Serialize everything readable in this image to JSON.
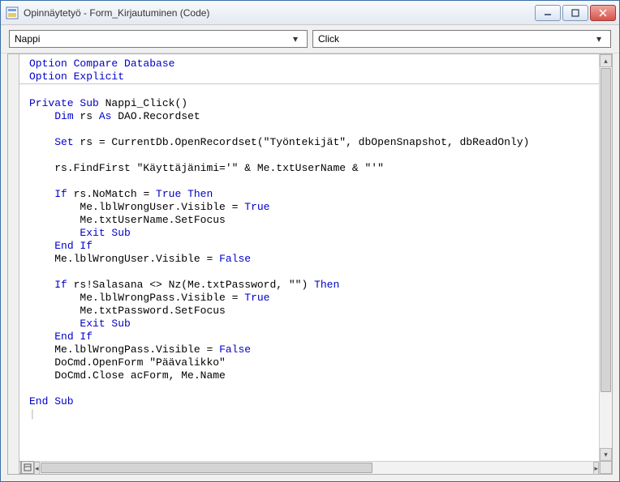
{
  "window": {
    "title": "Opinnäytetyö - Form_Kirjautuminen (Code)"
  },
  "dropdowns": {
    "object": "Nappi",
    "procedure": "Click"
  },
  "code": {
    "lines": [
      {
        "indent": 0,
        "tokens": [
          {
            "t": "Option Compare Database",
            "c": "kw"
          }
        ]
      },
      {
        "indent": 0,
        "tokens": [
          {
            "t": "Option Explicit",
            "c": "kw"
          }
        ]
      },
      {
        "hr": true
      },
      {
        "blank": true
      },
      {
        "indent": 0,
        "tokens": [
          {
            "t": "Private Sub",
            "c": "kw"
          },
          {
            "t": " Nappi_Click()"
          }
        ]
      },
      {
        "indent": 1,
        "tokens": [
          {
            "t": "Dim",
            "c": "kw"
          },
          {
            "t": " rs "
          },
          {
            "t": "As",
            "c": "kw"
          },
          {
            "t": " DAO.Recordset"
          }
        ]
      },
      {
        "blank": true
      },
      {
        "indent": 1,
        "tokens": [
          {
            "t": "Set",
            "c": "kw"
          },
          {
            "t": " rs = CurrentDb.OpenRecordset(\"Työntekijät\", dbOpenSnapshot, dbReadOnly)"
          }
        ]
      },
      {
        "blank": true
      },
      {
        "indent": 1,
        "tokens": [
          {
            "t": "rs.FindFirst \"Käyttäjänimi='\" & Me.txtUserName & \"'\""
          }
        ]
      },
      {
        "blank": true
      },
      {
        "indent": 1,
        "tokens": [
          {
            "t": "If",
            "c": "kw"
          },
          {
            "t": " rs.NoMatch = "
          },
          {
            "t": "True",
            "c": "kw"
          },
          {
            "t": " "
          },
          {
            "t": "Then",
            "c": "kw"
          }
        ]
      },
      {
        "indent": 2,
        "tokens": [
          {
            "t": "Me.lblWrongUser.Visible = "
          },
          {
            "t": "True",
            "c": "kw"
          }
        ]
      },
      {
        "indent": 2,
        "tokens": [
          {
            "t": "Me.txtUserName.SetFocus"
          }
        ]
      },
      {
        "indent": 2,
        "tokens": [
          {
            "t": "Exit Sub",
            "c": "kw"
          }
        ]
      },
      {
        "indent": 1,
        "tokens": [
          {
            "t": "End If",
            "c": "kw"
          }
        ]
      },
      {
        "indent": 1,
        "tokens": [
          {
            "t": "Me.lblWrongUser.Visible = "
          },
          {
            "t": "False",
            "c": "kw"
          }
        ]
      },
      {
        "blank": true
      },
      {
        "indent": 1,
        "tokens": [
          {
            "t": "If",
            "c": "kw"
          },
          {
            "t": " rs!Salasana <> Nz(Me.txtPassword, \"\") "
          },
          {
            "t": "Then",
            "c": "kw"
          }
        ]
      },
      {
        "indent": 2,
        "tokens": [
          {
            "t": "Me.lblWrongPass.Visible = "
          },
          {
            "t": "True",
            "c": "kw"
          }
        ]
      },
      {
        "indent": 2,
        "tokens": [
          {
            "t": "Me.txtPassword.SetFocus"
          }
        ]
      },
      {
        "indent": 2,
        "tokens": [
          {
            "t": "Exit Sub",
            "c": "kw"
          }
        ]
      },
      {
        "indent": 1,
        "tokens": [
          {
            "t": "End If",
            "c": "kw"
          }
        ]
      },
      {
        "indent": 1,
        "tokens": [
          {
            "t": "Me.lblWrongPass.Visible = "
          },
          {
            "t": "False",
            "c": "kw"
          }
        ]
      },
      {
        "indent": 1,
        "tokens": [
          {
            "t": "DoCmd.OpenForm \"Päävalikko\""
          }
        ]
      },
      {
        "indent": 1,
        "tokens": [
          {
            "t": "DoCmd.Close acForm, Me.Name"
          }
        ]
      },
      {
        "blank": true
      },
      {
        "indent": 0,
        "tokens": [
          {
            "t": "End Sub",
            "c": "kw"
          }
        ]
      }
    ]
  }
}
